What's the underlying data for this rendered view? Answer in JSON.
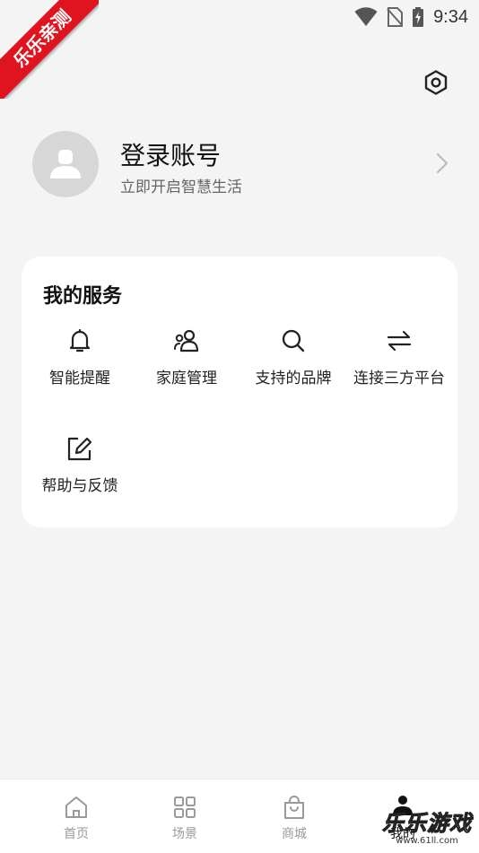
{
  "status_bar": {
    "time": "9:34"
  },
  "ribbon": {
    "text": "乐乐亲测"
  },
  "header": {
    "settings_icon": "settings-hexagon-icon"
  },
  "profile": {
    "title": "登录账号",
    "subtitle": "立即开启智慧生活",
    "avatar_icon": "user-avatar-icon",
    "arrow_icon": "chevron-right-icon"
  },
  "services": {
    "title": "我的服务",
    "items": [
      {
        "label": "智能提醒",
        "icon": "bell-icon"
      },
      {
        "label": "家庭管理",
        "icon": "family-icon"
      },
      {
        "label": "支持的品牌",
        "icon": "search-icon"
      },
      {
        "label": "连接三方平台",
        "icon": "swap-arrows-icon"
      },
      {
        "label": "帮助与反馈",
        "icon": "edit-feedback-icon"
      }
    ]
  },
  "bottom_nav": {
    "items": [
      {
        "label": "首页",
        "icon": "home-icon",
        "active": false
      },
      {
        "label": "场景",
        "icon": "grid-icon",
        "active": false
      },
      {
        "label": "商城",
        "icon": "shopping-bag-icon",
        "active": false
      },
      {
        "label": "我的",
        "icon": "person-icon",
        "active": true
      }
    ]
  },
  "watermark": {
    "text": "乐乐游戏",
    "url": "www.61ll.com"
  }
}
